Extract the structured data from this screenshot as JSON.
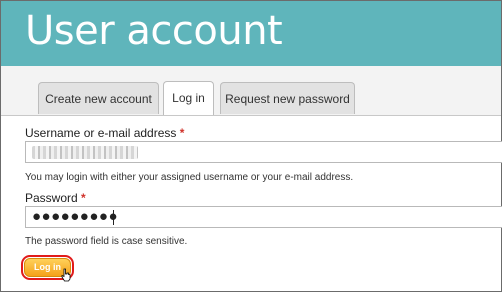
{
  "header": {
    "title": "User account",
    "background": "#5fb5bb"
  },
  "tabs": [
    {
      "label": "Create new account",
      "active": false
    },
    {
      "label": "Log in",
      "active": true
    },
    {
      "label": "Request new password",
      "active": false
    }
  ],
  "form": {
    "username": {
      "label": "Username or e-mail address",
      "required_mark": "*",
      "description": "You may login with either your assigned username or your e-mail address."
    },
    "password": {
      "label": "Password",
      "required_mark": "*",
      "value": "●●●●●●●●●",
      "description": "The password field is case sensitive."
    },
    "submit": {
      "label": "Log in",
      "color": "#f4a11a",
      "highlight": "#e11b1b"
    }
  },
  "icons": {
    "cursor": "hand-pointer-icon"
  }
}
